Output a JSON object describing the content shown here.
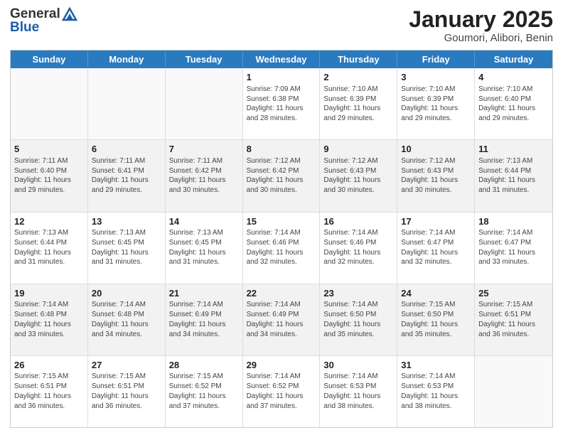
{
  "header": {
    "logo_general": "General",
    "logo_blue": "Blue",
    "month_year": "January 2025",
    "location": "Goumori, Alibori, Benin"
  },
  "days_of_week": [
    "Sunday",
    "Monday",
    "Tuesday",
    "Wednesday",
    "Thursday",
    "Friday",
    "Saturday"
  ],
  "weeks": [
    {
      "alt": false,
      "cells": [
        {
          "day": "",
          "empty": true
        },
        {
          "day": "",
          "empty": true
        },
        {
          "day": "",
          "empty": true
        },
        {
          "day": "1",
          "sunrise": "Sunrise: 7:09 AM",
          "sunset": "Sunset: 6:38 PM",
          "daylight": "Daylight: 11 hours and 28 minutes."
        },
        {
          "day": "2",
          "sunrise": "Sunrise: 7:10 AM",
          "sunset": "Sunset: 6:39 PM",
          "daylight": "Daylight: 11 hours and 29 minutes."
        },
        {
          "day": "3",
          "sunrise": "Sunrise: 7:10 AM",
          "sunset": "Sunset: 6:39 PM",
          "daylight": "Daylight: 11 hours and 29 minutes."
        },
        {
          "day": "4",
          "sunrise": "Sunrise: 7:10 AM",
          "sunset": "Sunset: 6:40 PM",
          "daylight": "Daylight: 11 hours and 29 minutes."
        }
      ]
    },
    {
      "alt": true,
      "cells": [
        {
          "day": "5",
          "sunrise": "Sunrise: 7:11 AM",
          "sunset": "Sunset: 6:40 PM",
          "daylight": "Daylight: 11 hours and 29 minutes."
        },
        {
          "day": "6",
          "sunrise": "Sunrise: 7:11 AM",
          "sunset": "Sunset: 6:41 PM",
          "daylight": "Daylight: 11 hours and 29 minutes."
        },
        {
          "day": "7",
          "sunrise": "Sunrise: 7:11 AM",
          "sunset": "Sunset: 6:42 PM",
          "daylight": "Daylight: 11 hours and 30 minutes."
        },
        {
          "day": "8",
          "sunrise": "Sunrise: 7:12 AM",
          "sunset": "Sunset: 6:42 PM",
          "daylight": "Daylight: 11 hours and 30 minutes."
        },
        {
          "day": "9",
          "sunrise": "Sunrise: 7:12 AM",
          "sunset": "Sunset: 6:43 PM",
          "daylight": "Daylight: 11 hours and 30 minutes."
        },
        {
          "day": "10",
          "sunrise": "Sunrise: 7:12 AM",
          "sunset": "Sunset: 6:43 PM",
          "daylight": "Daylight: 11 hours and 30 minutes."
        },
        {
          "day": "11",
          "sunrise": "Sunrise: 7:13 AM",
          "sunset": "Sunset: 6:44 PM",
          "daylight": "Daylight: 11 hours and 31 minutes."
        }
      ]
    },
    {
      "alt": false,
      "cells": [
        {
          "day": "12",
          "sunrise": "Sunrise: 7:13 AM",
          "sunset": "Sunset: 6:44 PM",
          "daylight": "Daylight: 11 hours and 31 minutes."
        },
        {
          "day": "13",
          "sunrise": "Sunrise: 7:13 AM",
          "sunset": "Sunset: 6:45 PM",
          "daylight": "Daylight: 11 hours and 31 minutes."
        },
        {
          "day": "14",
          "sunrise": "Sunrise: 7:13 AM",
          "sunset": "Sunset: 6:45 PM",
          "daylight": "Daylight: 11 hours and 31 minutes."
        },
        {
          "day": "15",
          "sunrise": "Sunrise: 7:14 AM",
          "sunset": "Sunset: 6:46 PM",
          "daylight": "Daylight: 11 hours and 32 minutes."
        },
        {
          "day": "16",
          "sunrise": "Sunrise: 7:14 AM",
          "sunset": "Sunset: 6:46 PM",
          "daylight": "Daylight: 11 hours and 32 minutes."
        },
        {
          "day": "17",
          "sunrise": "Sunrise: 7:14 AM",
          "sunset": "Sunset: 6:47 PM",
          "daylight": "Daylight: 11 hours and 32 minutes."
        },
        {
          "day": "18",
          "sunrise": "Sunrise: 7:14 AM",
          "sunset": "Sunset: 6:47 PM",
          "daylight": "Daylight: 11 hours and 33 minutes."
        }
      ]
    },
    {
      "alt": true,
      "cells": [
        {
          "day": "19",
          "sunrise": "Sunrise: 7:14 AM",
          "sunset": "Sunset: 6:48 PM",
          "daylight": "Daylight: 11 hours and 33 minutes."
        },
        {
          "day": "20",
          "sunrise": "Sunrise: 7:14 AM",
          "sunset": "Sunset: 6:48 PM",
          "daylight": "Daylight: 11 hours and 34 minutes."
        },
        {
          "day": "21",
          "sunrise": "Sunrise: 7:14 AM",
          "sunset": "Sunset: 6:49 PM",
          "daylight": "Daylight: 11 hours and 34 minutes."
        },
        {
          "day": "22",
          "sunrise": "Sunrise: 7:14 AM",
          "sunset": "Sunset: 6:49 PM",
          "daylight": "Daylight: 11 hours and 34 minutes."
        },
        {
          "day": "23",
          "sunrise": "Sunrise: 7:14 AM",
          "sunset": "Sunset: 6:50 PM",
          "daylight": "Daylight: 11 hours and 35 minutes."
        },
        {
          "day": "24",
          "sunrise": "Sunrise: 7:15 AM",
          "sunset": "Sunset: 6:50 PM",
          "daylight": "Daylight: 11 hours and 35 minutes."
        },
        {
          "day": "25",
          "sunrise": "Sunrise: 7:15 AM",
          "sunset": "Sunset: 6:51 PM",
          "daylight": "Daylight: 11 hours and 36 minutes."
        }
      ]
    },
    {
      "alt": false,
      "cells": [
        {
          "day": "26",
          "sunrise": "Sunrise: 7:15 AM",
          "sunset": "Sunset: 6:51 PM",
          "daylight": "Daylight: 11 hours and 36 minutes."
        },
        {
          "day": "27",
          "sunrise": "Sunrise: 7:15 AM",
          "sunset": "Sunset: 6:51 PM",
          "daylight": "Daylight: 11 hours and 36 minutes."
        },
        {
          "day": "28",
          "sunrise": "Sunrise: 7:15 AM",
          "sunset": "Sunset: 6:52 PM",
          "daylight": "Daylight: 11 hours and 37 minutes."
        },
        {
          "day": "29",
          "sunrise": "Sunrise: 7:14 AM",
          "sunset": "Sunset: 6:52 PM",
          "daylight": "Daylight: 11 hours and 37 minutes."
        },
        {
          "day": "30",
          "sunrise": "Sunrise: 7:14 AM",
          "sunset": "Sunset: 6:53 PM",
          "daylight": "Daylight: 11 hours and 38 minutes."
        },
        {
          "day": "31",
          "sunrise": "Sunrise: 7:14 AM",
          "sunset": "Sunset: 6:53 PM",
          "daylight": "Daylight: 11 hours and 38 minutes."
        },
        {
          "day": "",
          "empty": true
        }
      ]
    }
  ]
}
